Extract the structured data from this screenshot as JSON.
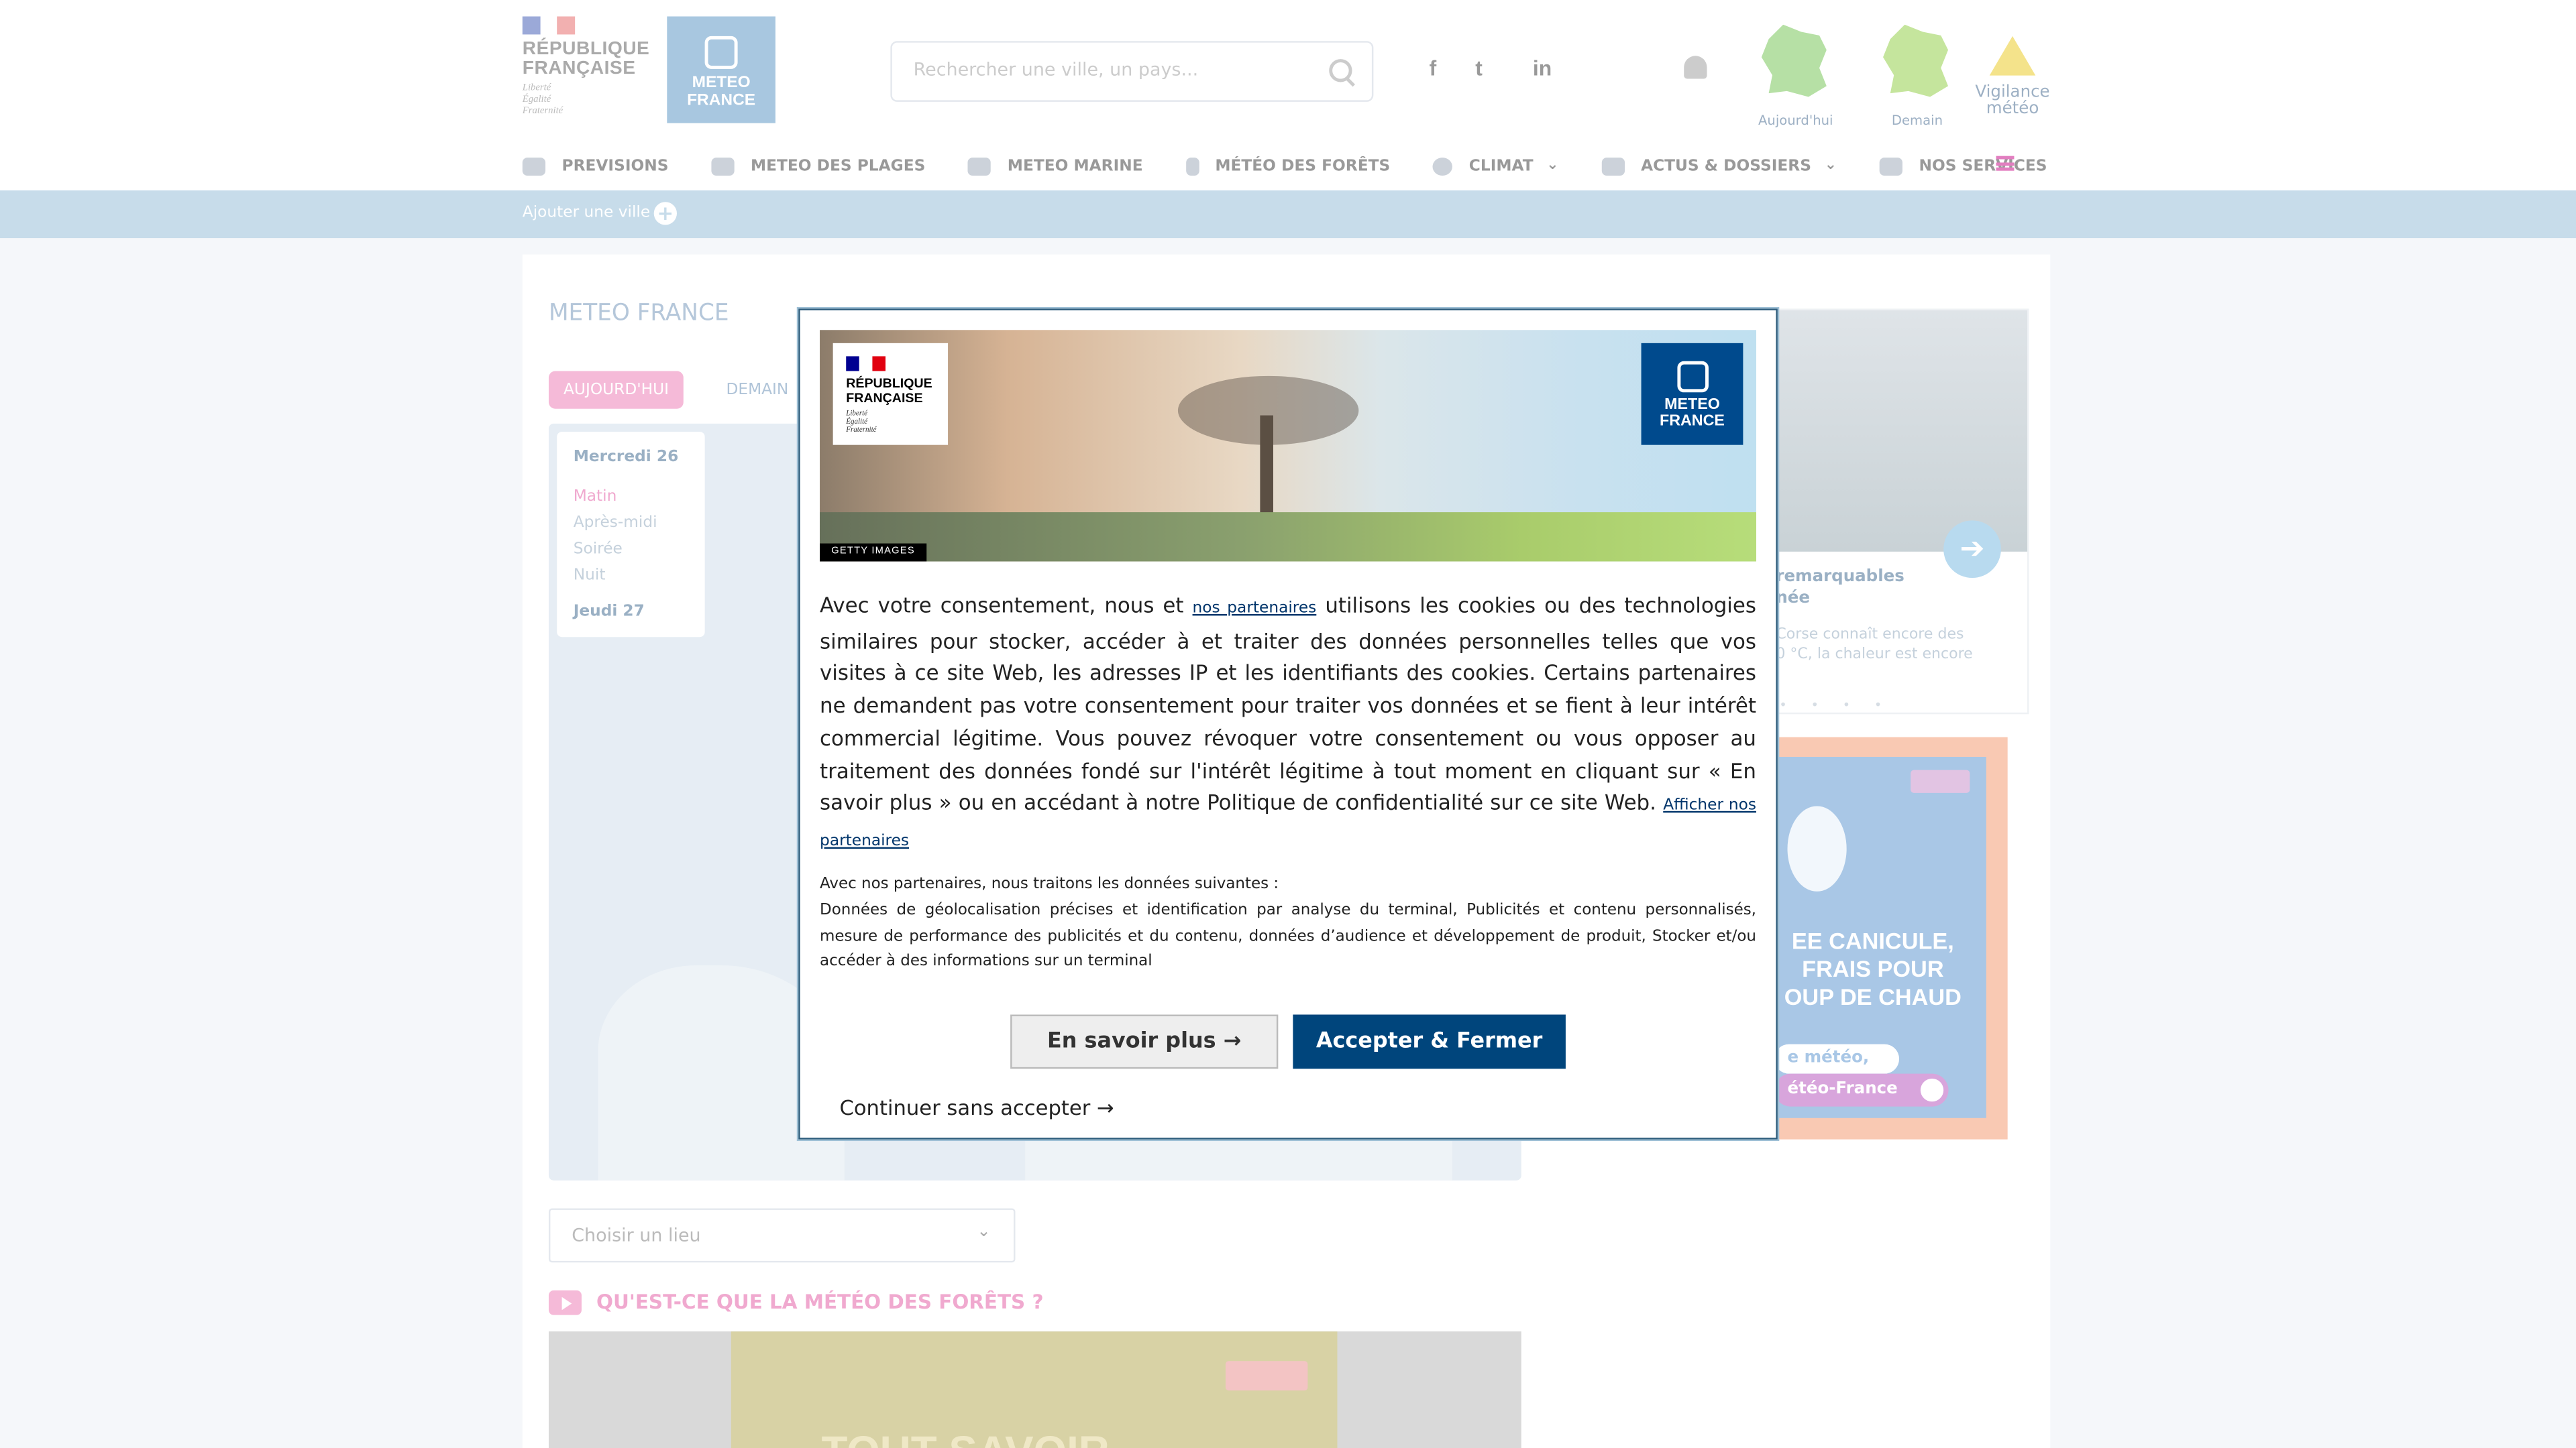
{
  "header": {
    "rf_logo": {
      "line1": "RÉPUBLIQUE",
      "line2": "FRANÇAISE",
      "motto1": "Liberté",
      "motto2": "Égalité",
      "motto3": "Fraternité"
    },
    "mf_logo": {
      "line1": "METEO",
      "line2": "FRANCE"
    },
    "search": {
      "placeholder": "Rechercher une ville, un pays..."
    },
    "social": [
      "f",
      "t",
      "in"
    ],
    "maps": [
      {
        "label": "Aujourd'hui"
      },
      {
        "label": "Demain"
      }
    ],
    "vigilance": {
      "line1": "Vigilance",
      "line2": "météo"
    }
  },
  "nav": {
    "items": [
      {
        "label": "PREVISIONS",
        "icon": "cloud-sun-icon"
      },
      {
        "label": "METEO DES PLAGES",
        "icon": "beach-umbrella-icon"
      },
      {
        "label": "METEO MARINE",
        "icon": "waves-icon"
      },
      {
        "label": "MÉTÉO DES FORÊTS",
        "icon": "tree-icon"
      },
      {
        "label": "CLIMAT",
        "icon": "globe-icon",
        "chevron": "⌄"
      },
      {
        "label": "ACTUS & DOSSIERS",
        "icon": "newspaper-icon",
        "chevron": "⌄"
      },
      {
        "label": "NOS SERVICES",
        "icon": "user-plus-icon"
      }
    ]
  },
  "city_band": {
    "add_label": "Ajouter une ville",
    "plus": "+"
  },
  "main": {
    "title": "METEO FRANCE",
    "tabs": {
      "today": "AUJOURD'HUI",
      "tomorrow": "DEMAIN"
    },
    "days": {
      "day1": "Mercredi 26",
      "periods": [
        "Matin",
        "Après-midi",
        "Soirée",
        "Nuit"
      ],
      "day2": "Jeudi 27"
    },
    "select": {
      "value": "Choisir un lieu",
      "chevron": "⌄"
    },
    "video_title": "QU'EST-CE QUE LA MÉTÉO DES FORÊTS ?",
    "video_text": "TOUT SAVOIR"
  },
  "side_card": {
    "heading_line1": "remarquables",
    "heading_line2": "née",
    "text_line1": "Corse connaît encore des",
    "text_line2": "0 °C, la chaleur est encore",
    "arrow": "➔",
    "dots": "• • • •"
  },
  "ad": {
    "line1": "EE CANICULE,",
    "line2": "FRAIS POUR",
    "line3": "OUP DE CHAUD",
    "pill1": "e météo,",
    "pill2": "étéo-France"
  },
  "consent": {
    "banner": {
      "rf_line1": "RÉPUBLIQUE",
      "rf_line2": "FRANÇAISE",
      "rf_motto1": "Liberté",
      "rf_motto2": "Égalité",
      "rf_motto3": "Fraternité",
      "mf_line1": "METEO",
      "mf_line2": "FRANCE",
      "credit": "GETTY IMAGES"
    },
    "text_part1": "Avec votre consentement, nous et",
    "partners_link": "nos partenaires",
    "text_part2": "utilisons les cookies ou des technologies similaires pour stocker, accéder à et traiter des données personnelles telles que vos visites à ce site Web, les adresses IP et les identifiants des cookies. Certains partenaires ne demandent pas votre consentement pour traiter vos données et se fient à leur intérêt commercial légitime. Vous pouvez révoquer votre consentement ou vous opposer au traitement des données fondé sur l'intérêt légitime à tout moment en cliquant sur « En savoir plus » ou en accédant à notre Politique de confidentialité sur ce site Web.",
    "show_partners_link": "Afficher nos partenaires",
    "data_intro": "Avec nos partenaires, nous traitons les données suivantes :",
    "data_list": "Données de géolocalisation précises et identification par analyse du terminal, Publicités et contenu personnalisés, mesure de performance des publicités et du contenu, données d’audience et développement de produit, Stocker et/ou accéder à des informations sur un terminal",
    "btn_more": "En savoir plus →",
    "btn_accept": "Accepter & Fermer",
    "btn_skip": "Continuer sans accepter →"
  },
  "colors": {
    "mf_blue": "#00457c",
    "accent_pink": "#e27ec0",
    "band": "#c7dcea"
  }
}
